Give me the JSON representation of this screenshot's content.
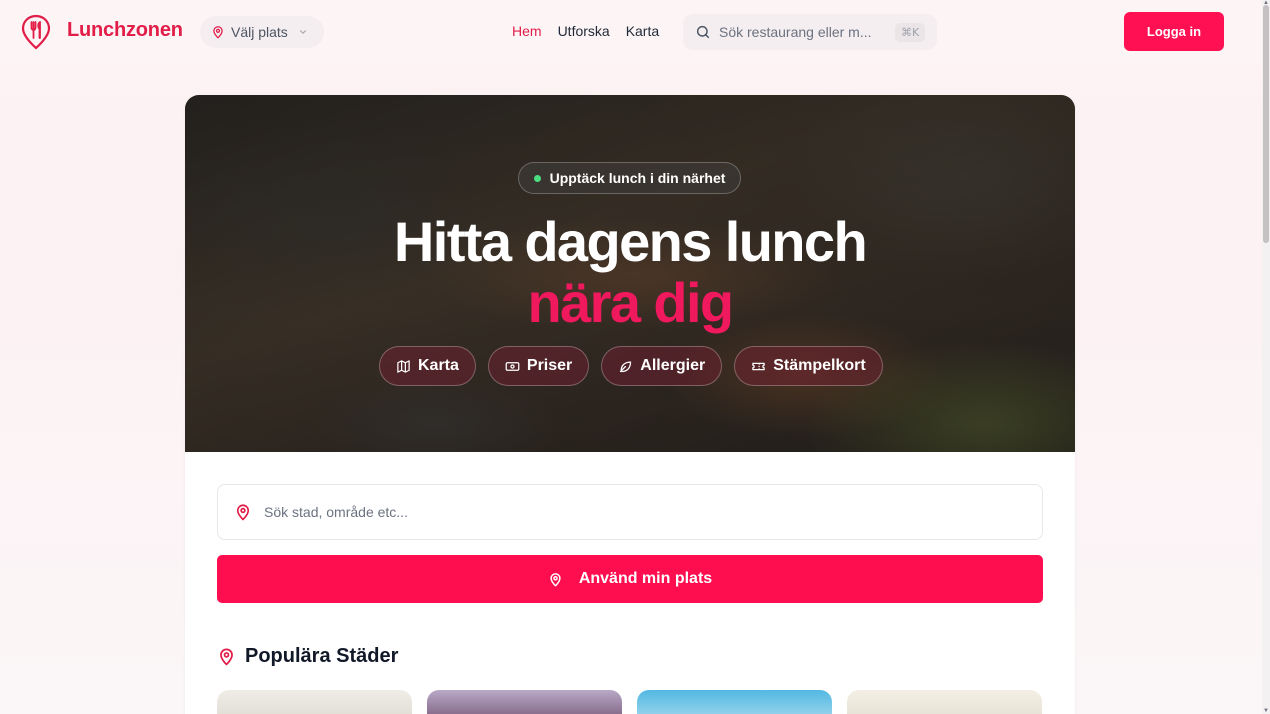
{
  "header": {
    "logo_text": "Lunchzonen",
    "place_select": "Välj plats",
    "nav": [
      {
        "label": "Hem",
        "active": true
      },
      {
        "label": "Utforska",
        "active": false
      },
      {
        "label": "Karta",
        "active": false
      }
    ],
    "search_placeholder": "Sök restaurang eller m...",
    "search_shortcut": "⌘K",
    "login_label": "Logga in"
  },
  "hero": {
    "pill_text": "Upptäck lunch i din närhet",
    "title_line1": "Hitta dagens lunch",
    "title_line2": "nära dig",
    "chips": [
      {
        "label": "Karta",
        "icon": "map-icon"
      },
      {
        "label": "Priser",
        "icon": "banknote-icon"
      },
      {
        "label": "Allergier",
        "icon": "leaf-icon"
      },
      {
        "label": "Stämpelkort",
        "icon": "ticket-icon"
      }
    ]
  },
  "location": {
    "search_placeholder": "Sök stad, område etc...",
    "use_location_label": "Använd min plats"
  },
  "popular": {
    "title": "Populära Städer"
  },
  "colors": {
    "brand": "#e11d48",
    "button": "#ff0e4f",
    "accent_title": "#f0195d",
    "status_dot": "#4ade80"
  }
}
